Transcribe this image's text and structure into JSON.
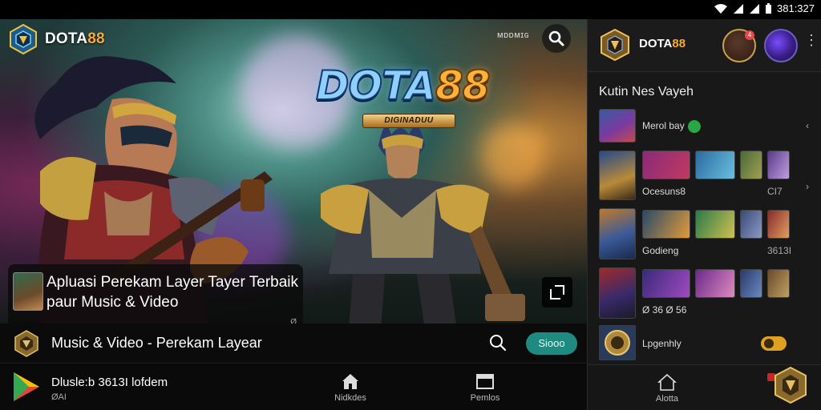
{
  "status_bar": {
    "time": "381:327"
  },
  "hero": {
    "brand_text": "DOTA",
    "brand_num": "88",
    "top_label": "ᴍᴅᴅᴍɪɢ",
    "logo_title": "DOTA",
    "logo_num": "88",
    "logo_sub": "DIGINADUU",
    "caption_line1": "Apluasi Perekam Layer Tayer Terbaik",
    "caption_line2": "paur Music & Video",
    "caption_small": "Ø"
  },
  "info_row": {
    "title": "Music & Video - Perekam Layear",
    "button_label": "Siooo"
  },
  "bottom_bar": {
    "title": "Dlusle:b 3613I lofdem",
    "subtitle": "ØAI",
    "tab_home": "Nidkdes",
    "tab_pages": "Pemlos"
  },
  "right_panel": {
    "brand_text": "DOTA",
    "brand_num": "88",
    "badge": "4",
    "section_title": "Kutin Nes Vayeh",
    "rows": [
      {
        "label": "Merol bay",
        "side": ""
      },
      {
        "label": "Ocesuns8",
        "side": "CI7"
      },
      {
        "label": "Godieng",
        "side": "3613I"
      },
      {
        "label": "Ø 36  Ø 56",
        "side": ""
      },
      {
        "label": "Lpgenhly",
        "side": ""
      }
    ],
    "tab_home": "Alotta"
  },
  "colors": {
    "accent_teal": "#1f8a7f",
    "brand_orange": "#f7a83a",
    "panel_bg": "#181818"
  }
}
